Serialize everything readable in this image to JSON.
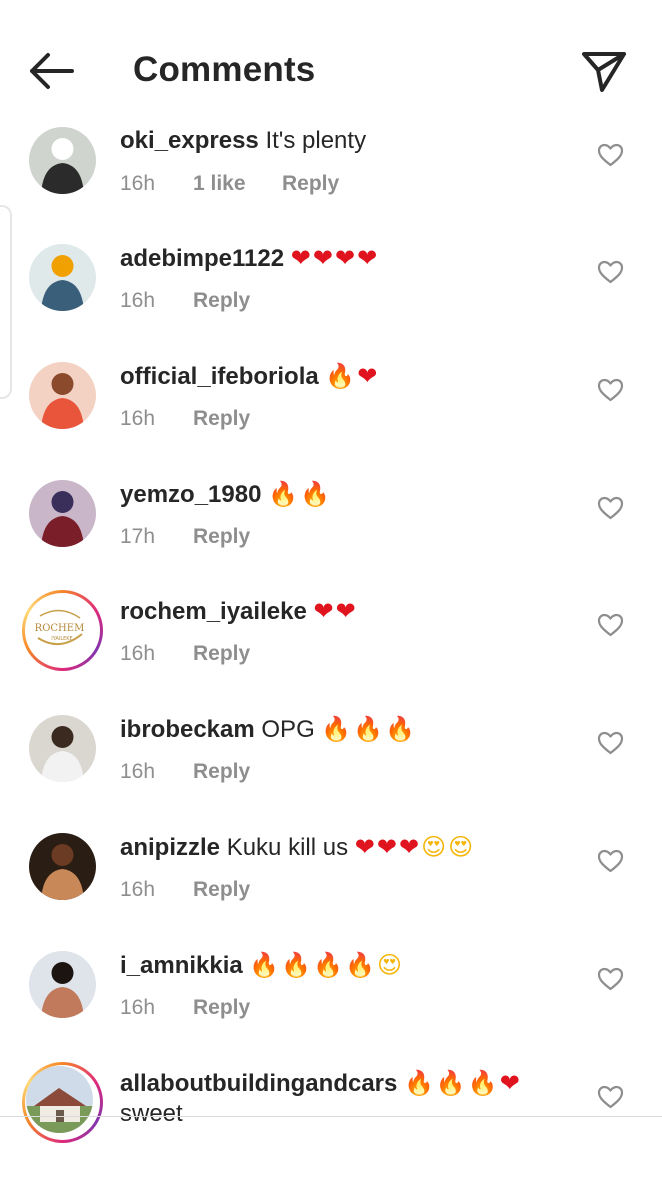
{
  "header": {
    "title": "Comments",
    "back_icon": "arrow-left-icon",
    "share_icon": "paper-plane-icon"
  },
  "colors": {
    "text": "#262626",
    "meta": "#8e8e8e",
    "heart_emoji": "#e0141e",
    "fire_emoji": "#f07a10",
    "story_ring": "#dd2a7b"
  },
  "comments": [
    {
      "username": "oki_express",
      "text": "It's plenty",
      "emojis": [],
      "time": "16h",
      "likes": "1 like",
      "reply": "Reply"
    },
    {
      "username": "adebimpe1122",
      "text": "",
      "emojis": [
        "heart",
        "heart",
        "heart",
        "heart"
      ],
      "time": "16h",
      "likes": "",
      "reply": "Reply"
    },
    {
      "username": "official_ifeboriola",
      "text": "",
      "emojis": [
        "fire",
        "heart"
      ],
      "time": "16h",
      "likes": "",
      "reply": "Reply"
    },
    {
      "username": "yemzo_1980",
      "text": "",
      "emojis": [
        "fire",
        "fire"
      ],
      "time": "17h",
      "likes": "",
      "reply": "Reply"
    },
    {
      "username": "rochem_iyaileke",
      "text": "",
      "emojis": [
        "heart",
        "heart"
      ],
      "time": "16h",
      "likes": "",
      "reply": "Reply",
      "avatar_logo_text": "ROCHEM IYAILEKE"
    },
    {
      "username": "ibrobeckam",
      "text": "OPG",
      "emojis": [
        "fire",
        "fire",
        "fire"
      ],
      "time": "16h",
      "likes": "",
      "reply": "Reply"
    },
    {
      "username": "anipizzle",
      "text": "Kuku kill us",
      "emojis": [
        "heart",
        "heart",
        "heart",
        "heart-eyes",
        "heart-eyes"
      ],
      "time": "16h",
      "likes": "",
      "reply": "Reply"
    },
    {
      "username": "i_amnikkia",
      "text": "",
      "emojis": [
        "fire",
        "fire",
        "fire",
        "fire",
        "heart-eyes"
      ],
      "time": "16h",
      "likes": "",
      "reply": "Reply"
    },
    {
      "username": "allaboutbuildingandcars",
      "text": "sweet",
      "emojis": [
        "fire",
        "fire",
        "fire",
        "heart"
      ],
      "time": "",
      "likes": "",
      "reply": ""
    }
  ]
}
